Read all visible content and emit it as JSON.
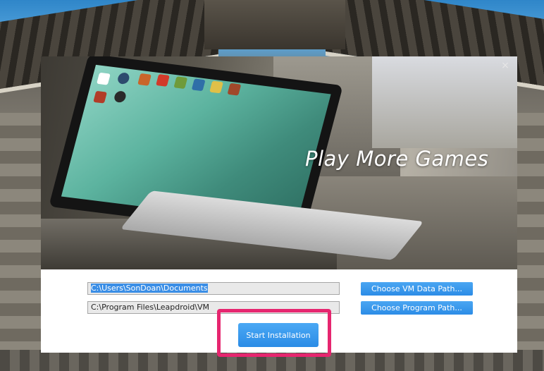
{
  "installer": {
    "banner_title": "Play More Games",
    "close_glyph": "×",
    "vm_data_path": "C:\\Users\\SonDoan\\Documents",
    "program_path": "C:\\Program Files\\Leapdroid\\VM",
    "choose_vm_data_button": "Choose VM Data Path...",
    "choose_program_button": "Choose Program Path...",
    "start_button": "Start Installation"
  },
  "colors": {
    "button_blue": "#2c8ce6",
    "highlight_pink": "#e6266f",
    "selection_blue": "#3a8ee6"
  },
  "icons": [
    "close-icon",
    "laptop-illustration",
    "app-icon"
  ]
}
